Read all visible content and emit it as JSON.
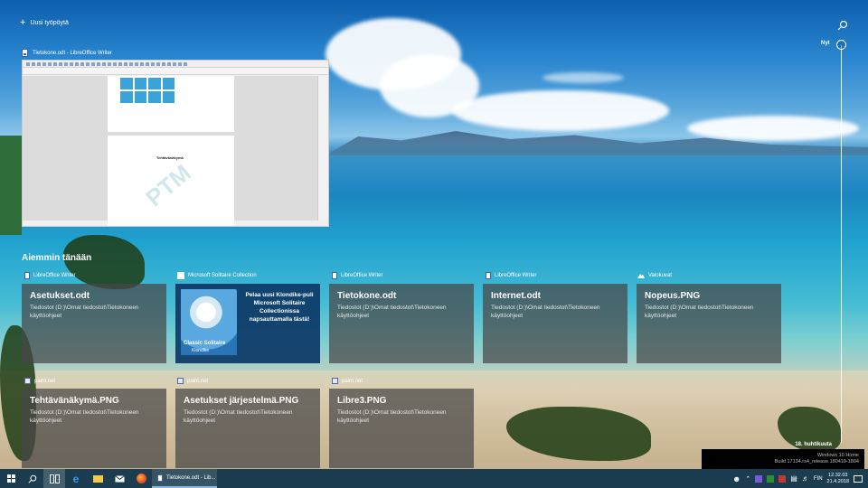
{
  "topbar": {
    "new_desktop_label": "Uusi työpöytä"
  },
  "timeline": {
    "now_label": "Nyt",
    "end_label": "18. huhtikuuta"
  },
  "current_window": {
    "title": "Tietokone.odt - LibreOffice Writer",
    "doc_heading": "Tehtävänäkymä"
  },
  "section_title": "Aiemmin tänään",
  "cards_row1": [
    {
      "app": "LibreOffice Writer",
      "icon": "writer-doc-icon",
      "title": "Asetukset.odt",
      "path": "Tiedostot (D:)\\Omat tiedostot\\Tietokoneen käyttöohjeet"
    },
    {
      "app": "Microsoft Solitaire Collection",
      "icon": "solitaire-icon",
      "ad_text": "Pelaa uusi Klondike-puli Microsoft Solitaire Collectionissa napsauttamalla tästä!",
      "ad_caption": "Classic Solitaire",
      "ad_sub": "Klondike"
    },
    {
      "app": "LibreOffice Writer",
      "icon": "writer-doc-icon",
      "title": "Tietokone.odt",
      "path": "Tiedostot (D:)\\Omat tiedostot\\Tietokoneen käyttöohjeet"
    },
    {
      "app": "LibreOffice Writer",
      "icon": "writer-doc-icon",
      "title": "Internet.odt",
      "path": "Tiedostot (D:)\\Omat tiedostot\\Tietokoneen käyttöohjeet"
    },
    {
      "app": "Valokuvat",
      "icon": "photos-icon",
      "title": "Nopeus.PNG",
      "path": "Tiedostot (D:)\\Omat tiedostot\\Tietokoneen käyttöohjeet"
    }
  ],
  "cards_row2": [
    {
      "app": "paint.net",
      "icon": "paintnet-icon",
      "title": "Tehtävänäkymä.PNG",
      "path": "Tiedostot (D:)\\Omat tiedostot\\Tietokoneen käyttöohjeet"
    },
    {
      "app": "paint.net",
      "icon": "paintnet-icon",
      "title": "Asetukset järjestelmä.PNG",
      "path": "Tiedostot (D:)\\Omat tiedostot\\Tietokoneen käyttöohjeet"
    },
    {
      "app": "paint.net",
      "icon": "paintnet-icon",
      "title": "Libre3.PNG",
      "path": "Tiedostot (D:)\\Omat tiedostot\\Tietokoneen käyttöohjeet"
    }
  ],
  "taskbar": {
    "active_app_label": "Tietokone.odt - Lib...",
    "language": "FIN",
    "time": "12.32.03",
    "date": "21.4.2018"
  },
  "build_watermark": {
    "line1": "Windows 10 Home",
    "line2": "Build 17134.rs4_release.180410-1804"
  },
  "colors": {
    "taskbar_bg": "#1c3d4f",
    "card_bg": "#464646",
    "ad_bg": "#0f3c69",
    "accent": "#8fb8e8"
  }
}
